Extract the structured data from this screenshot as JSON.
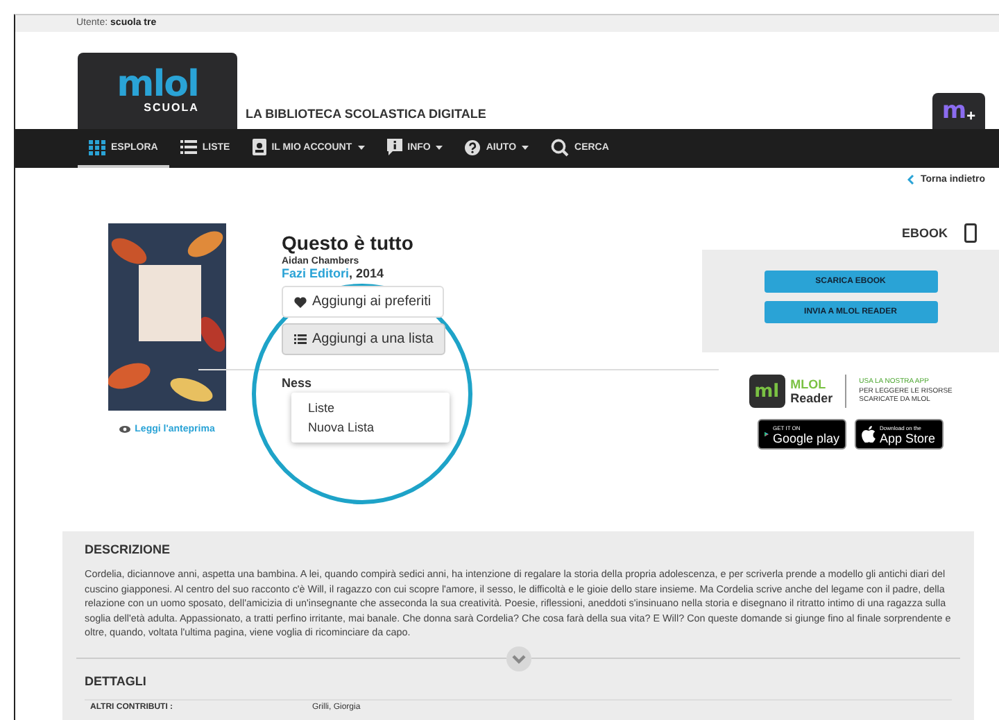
{
  "user_bar": {
    "label": "Utente:",
    "user": "scuola tre"
  },
  "header": {
    "logo_text": "mlol",
    "logo_sub": "SCUOLA",
    "tagline": "LA BIBLIOTECA SCOLASTICA DIGITALE",
    "badge": "m",
    "badge_plus": "+"
  },
  "nav": [
    {
      "label": "ESPLORA",
      "selected": true,
      "dropdown": false
    },
    {
      "label": "LISTE",
      "selected": false,
      "dropdown": false
    },
    {
      "label": "IL MIO ACCOUNT",
      "selected": false,
      "dropdown": true
    },
    {
      "label": "INFO",
      "selected": false,
      "dropdown": true
    },
    {
      "label": "AIUTO",
      "selected": false,
      "dropdown": true
    },
    {
      "label": "CERCA",
      "selected": false,
      "dropdown": false
    }
  ],
  "back_link": "Torna indietro",
  "book": {
    "title": "Questo è tutto",
    "author": "Aidan Chambers",
    "publisher": "Fazi Editori",
    "year": ", 2014",
    "preview_link": "Leggi l'anteprima"
  },
  "actions": {
    "favorite": "Aggiungi ai preferiti",
    "add_to_list": "Aggiungi a una lista",
    "rating_partial": "Ness",
    "list_menu": [
      "Liste",
      "Nuova Lista"
    ]
  },
  "format": {
    "label": "EBOOK",
    "buttons": [
      "SCARICA EBOOK",
      "INVIA A MLOL READER"
    ]
  },
  "app_promo": {
    "logo": "ml",
    "name": "MLOL",
    "name2": "Reader",
    "lines": [
      "USA LA NOSTRA APP",
      "PER LEGGERE LE RISORSE",
      "SCARICATE DA MLOL"
    ],
    "stores": [
      {
        "kind": "google",
        "small": "GET IT ON",
        "big": "Google play"
      },
      {
        "kind": "apple",
        "small": "Download on the",
        "big": "App Store"
      }
    ]
  },
  "description": {
    "heading": "DESCRIZIONE",
    "text": "Cordelia, diciannove anni, aspetta una bambina. A lei, quando compirà sedici anni, ha intenzione di regalare la storia della propria adolescenza, e per scriverla prende a modello gli antichi diari del cuscino giapponesi. Al centro del suo racconto c'è Will, il ragazzo con cui scopre l'amore, il sesso, le difficoltà e le gioie dello stare insieme. Ma Cordelia scrive anche del legame con il padre, della relazione con un uomo sposato, dell'amicizia di un'insegnante che asseconda la sua creatività. Poesie, riflessioni, aneddoti s'insinuano nella storia e disegnano il ritratto intimo di una ragazza sulla soglia dell'età adulta. Appassionato, a tratti perfino irritante, mai banale. Che donna sarà Cordelia? Che cosa farà della sua vita? E Will? Con queste domande si giunge fino al finale sorprendente e oltre, quando, voltata l'ultima pagina, viene voglia di ricominciare da capo."
  },
  "details": {
    "heading": "DETTAGLI",
    "rows": [
      {
        "label": "ALTRI CONTRIBUTI :",
        "value": "Grilli, Giorgia"
      }
    ]
  }
}
